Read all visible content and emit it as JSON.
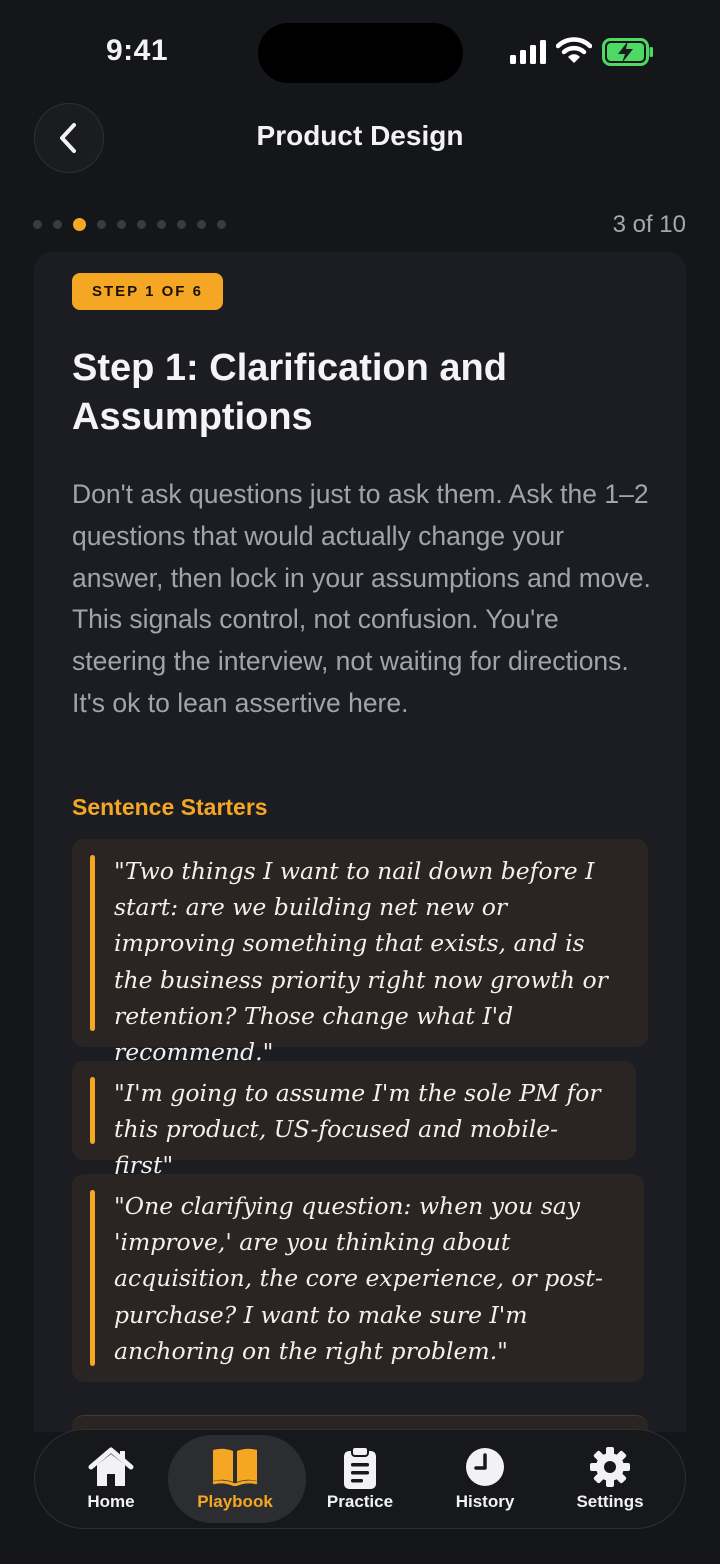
{
  "status_bar": {
    "time": "9:41"
  },
  "header": {
    "title": "Product Design"
  },
  "progress": {
    "counter": "3 of 10",
    "current": 3,
    "total": 10
  },
  "step": {
    "badge": "STEP 1 OF 6",
    "title": "Step 1: Clarification and Assumptions",
    "body": "Don't ask questions just to ask them. Ask the 1–2 questions that would actually change your answer, then lock in your assumptions and move. This signals control, not confusion. You're steering the interview, not waiting for directions. It's ok to lean assertive here."
  },
  "starters": {
    "heading": "Sentence Starters",
    "items": [
      "\"Two things I want to nail down before I start: are we building net new or improving something that exists, and is the business priority right now growth or retention? Those change what I'd recommend.\"",
      "\"I'm going to assume I'm the sole PM for this product, US-focused and mobile-first\"",
      "\"One clarifying question: when you say 'improve,' are you thinking about acquisition, the core experience, or post-purchase? I want to make sure I'm anchoring on the right problem.\""
    ]
  },
  "tabs": [
    {
      "label": "Home",
      "icon": "home-icon"
    },
    {
      "label": "Playbook",
      "icon": "book-icon",
      "active": true
    },
    {
      "label": "Practice",
      "icon": "clipboard-icon"
    },
    {
      "label": "History",
      "icon": "clock-icon"
    },
    {
      "label": "Settings",
      "icon": "gear-icon"
    }
  ],
  "colors": {
    "accent": "#f5a623",
    "background": "#15161a",
    "card": "#1c1d22",
    "quote_bg": "#2a2422",
    "battery": "#4cd964"
  }
}
